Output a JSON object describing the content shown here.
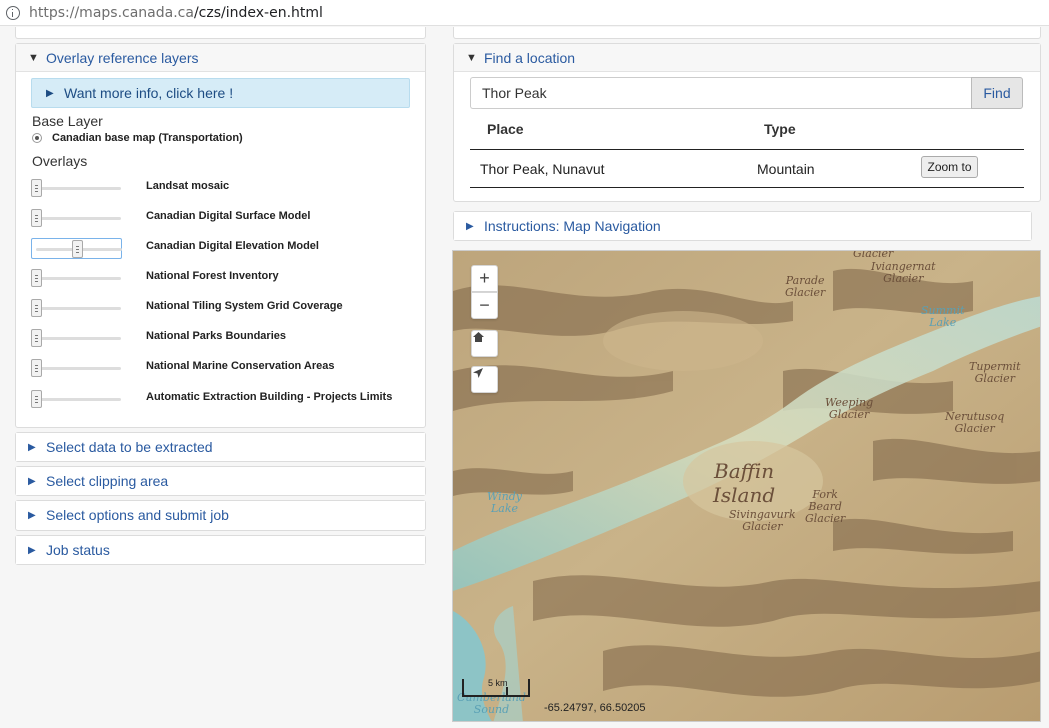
{
  "browser": {
    "url_host": "https://maps.canada.ca",
    "url_path": "/czs/index-en.html"
  },
  "overlay_panel": {
    "title": "Overlay reference layers",
    "info_label": "Want more info, click here !",
    "base_layer_heading": "Base Layer",
    "base_layer_option": "Canadian base map (Transportation)",
    "overlays_heading": "Overlays",
    "overlays": [
      {
        "label": "Landsat mosaic",
        "opacity": 0
      },
      {
        "label": "Canadian Digital Surface Model",
        "opacity": 0
      },
      {
        "label": "Canadian Digital Elevation Model",
        "opacity": 0.5
      },
      {
        "label": "National Forest Inventory",
        "opacity": 0
      },
      {
        "label": "National Tiling System Grid Coverage",
        "opacity": 0
      },
      {
        "label": "National Parks Boundaries",
        "opacity": 0
      },
      {
        "label": "National Marine Conservation Areas",
        "opacity": 0
      },
      {
        "label": "Automatic Extraction Building - Projects Limits",
        "opacity": 0
      }
    ]
  },
  "collapsed_sections": [
    "Select data to be extracted",
    "Select clipping area",
    "Select options and submit job",
    "Job status"
  ],
  "find_panel": {
    "title": "Find a location",
    "search_value": "Thor Peak",
    "find_label": "Find",
    "col_place": "Place",
    "col_type": "Type",
    "results": [
      {
        "place": "Thor Peak, Nunavut",
        "type": "Mountain",
        "action": "Zoom to"
      }
    ]
  },
  "instructions_panel": {
    "title": "Instructions: Map Navigation"
  },
  "map": {
    "zoom_in": "+",
    "zoom_out": "−",
    "scale_label": "5 km",
    "coordinates": "-65.24797, 66.50205",
    "place_labels": [
      {
        "text": "Glacier",
        "kind": "glacier"
      },
      {
        "text": "Iviangernat\nGlacier",
        "kind": "glacier"
      },
      {
        "text": "Parade\nGlacier",
        "kind": "glacier"
      },
      {
        "text": "Summit\nLake",
        "kind": "water"
      },
      {
        "text": "Tupermit\nGlacier",
        "kind": "glacier"
      },
      {
        "text": "Weeping\nGlacier",
        "kind": "glacier"
      },
      {
        "text": "Nerutusoq\nGlacier",
        "kind": "glacier"
      },
      {
        "text": "Baffin\nIsland",
        "kind": "island"
      },
      {
        "text": "Fork\nBeard\nGlacier",
        "kind": "glacier"
      },
      {
        "text": "Sivingavurk\nGlacier",
        "kind": "glacier"
      },
      {
        "text": "Windy\nLake",
        "kind": "water"
      },
      {
        "text": "Cumberland\nSound",
        "kind": "water"
      }
    ]
  }
}
